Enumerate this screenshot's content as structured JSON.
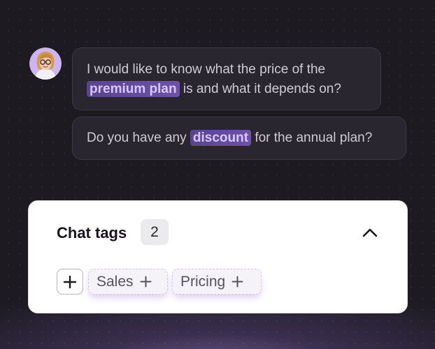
{
  "chat": {
    "messages": [
      {
        "parts": [
          {
            "text": "I would like to know what the price of the ",
            "highlight": false
          },
          {
            "text": "premium plan",
            "highlight": true
          },
          {
            "text": " is and what it depends on?",
            "highlight": false
          }
        ]
      },
      {
        "parts": [
          {
            "text": "Do you have any ",
            "highlight": false
          },
          {
            "text": "discount",
            "highlight": true
          },
          {
            "text": " for the annual plan?",
            "highlight": false
          }
        ]
      }
    ],
    "avatar_icon": "user-avatar-woman-glasses"
  },
  "tags_panel": {
    "title": "Chat tags",
    "count": "2",
    "collapse_icon": "chevron-up-icon",
    "add_icon": "plus-icon",
    "tags": [
      {
        "label": "Sales"
      },
      {
        "label": "Pricing"
      }
    ]
  },
  "colors": {
    "background": "#1d1a22",
    "bubble": "#2a2630",
    "highlight": "#6d52a8",
    "highlight_text": "#d8c8ff",
    "panel": "#ffffff",
    "glow": "#a78bd8"
  }
}
